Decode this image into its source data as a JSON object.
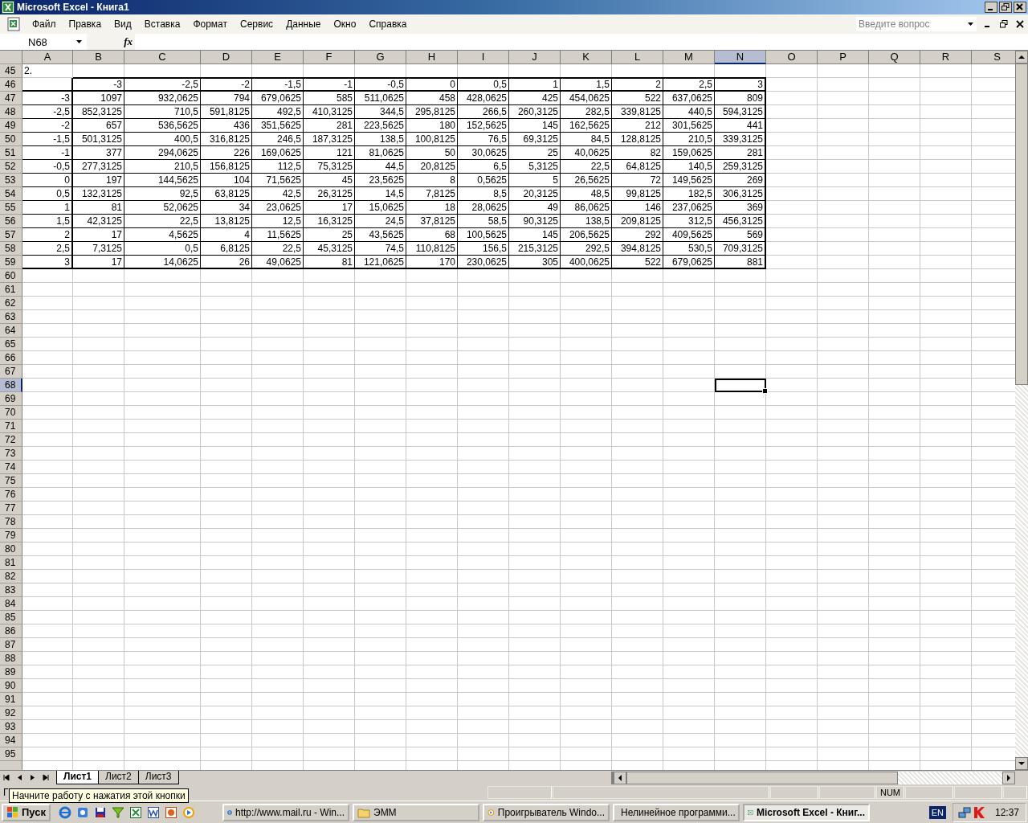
{
  "window": {
    "title": "Microsoft Excel - Книга1"
  },
  "menu": [
    "Файл",
    "Правка",
    "Вид",
    "Вставка",
    "Формат",
    "Сервис",
    "Данные",
    "Окно",
    "Справка"
  ],
  "help_search": {
    "placeholder": "Введите вопрос"
  },
  "name_box": {
    "value": "N68"
  },
  "formula_bar": {
    "label": "fx"
  },
  "sheet": {
    "columns": [
      {
        "label": "A",
        "selected": false
      },
      {
        "label": "B",
        "selected": false
      },
      {
        "label": "C",
        "selected": false
      },
      {
        "label": "D",
        "selected": false
      },
      {
        "label": "E",
        "selected": false
      },
      {
        "label": "F",
        "selected": false
      },
      {
        "label": "G",
        "selected": false
      },
      {
        "label": "H",
        "selected": false
      },
      {
        "label": "I",
        "selected": false
      },
      {
        "label": "J",
        "selected": false
      },
      {
        "label": "K",
        "selected": false
      },
      {
        "label": "L",
        "selected": false
      },
      {
        "label": "M",
        "selected": false
      },
      {
        "label": "N",
        "selected": true
      },
      {
        "label": "O",
        "selected": false
      },
      {
        "label": "P",
        "selected": false
      },
      {
        "label": "Q",
        "selected": false
      },
      {
        "label": "R",
        "selected": false
      },
      {
        "label": "S",
        "selected": false
      }
    ],
    "rows": [
      {
        "number": "45",
        "kind": "note",
        "selected": false,
        "cells": [
          "2."
        ]
      },
      {
        "number": "46",
        "kind": "table-head",
        "selected": false,
        "cells": [
          null,
          "-3",
          "-2,5",
          "-2",
          "-1,5",
          "-1",
          "-0,5",
          "0",
          "0,5",
          "1",
          "1,5",
          "2",
          "2,5",
          "3"
        ]
      },
      {
        "number": "47",
        "kind": "table-body",
        "selected": false,
        "cells": [
          "-3",
          "1097",
          "932,0625",
          "794",
          "679,0625",
          "585",
          "511,0625",
          "458",
          "428,0625",
          "425",
          "454,0625",
          "522",
          "637,0625",
          "809"
        ]
      },
      {
        "number": "48",
        "kind": "table-body",
        "selected": false,
        "cells": [
          "-2,5",
          "852,3125",
          "710,5",
          "591,8125",
          "492,5",
          "410,3125",
          "344,5",
          "295,8125",
          "266,5",
          "260,3125",
          "282,5",
          "339,8125",
          "440,5",
          "594,3125"
        ]
      },
      {
        "number": "49",
        "kind": "table-body",
        "selected": false,
        "cells": [
          "-2",
          "657",
          "536,5625",
          "436",
          "351,5625",
          "281",
          "223,5625",
          "180",
          "152,5625",
          "145",
          "162,5625",
          "212",
          "301,5625",
          "441"
        ]
      },
      {
        "number": "50",
        "kind": "table-body",
        "selected": false,
        "cells": [
          "-1,5",
          "501,3125",
          "400,5",
          "316,8125",
          "246,5",
          "187,3125",
          "138,5",
          "100,8125",
          "76,5",
          "69,3125",
          "84,5",
          "128,8125",
          "210,5",
          "339,3125"
        ]
      },
      {
        "number": "51",
        "kind": "table-body",
        "selected": false,
        "cells": [
          "-1",
          "377",
          "294,0625",
          "226",
          "169,0625",
          "121",
          "81,0625",
          "50",
          "30,0625",
          "25",
          "40,0625",
          "82",
          "159,0625",
          "281"
        ]
      },
      {
        "number": "52",
        "kind": "table-body",
        "selected": false,
        "cells": [
          "-0,5",
          "277,3125",
          "210,5",
          "156,8125",
          "112,5",
          "75,3125",
          "44,5",
          "20,8125",
          "6,5",
          "5,3125",
          "22,5",
          "64,8125",
          "140,5",
          "259,3125"
        ]
      },
      {
        "number": "53",
        "kind": "table-body",
        "selected": false,
        "cells": [
          "0",
          "197",
          "144,5625",
          "104",
          "71,5625",
          "45",
          "23,5625",
          "8",
          "0,5625",
          "5",
          "26,5625",
          "72",
          "149,5625",
          "269"
        ]
      },
      {
        "number": "54",
        "kind": "table-body",
        "selected": false,
        "cells": [
          "0,5",
          "132,3125",
          "92,5",
          "63,8125",
          "42,5",
          "26,3125",
          "14,5",
          "7,8125",
          "8,5",
          "20,3125",
          "48,5",
          "99,8125",
          "182,5",
          "306,3125"
        ]
      },
      {
        "number": "55",
        "kind": "table-body",
        "selected": false,
        "cells": [
          "1",
          "81",
          "52,0625",
          "34",
          "23,0625",
          "17",
          "15,0625",
          "18",
          "28,0625",
          "49",
          "86,0625",
          "146",
          "237,0625",
          "369"
        ]
      },
      {
        "number": "56",
        "kind": "table-body",
        "selected": false,
        "cells": [
          "1,5",
          "42,3125",
          "22,5",
          "13,8125",
          "12,5",
          "16,3125",
          "24,5",
          "37,8125",
          "58,5",
          "90,3125",
          "138,5",
          "209,8125",
          "312,5",
          "456,3125"
        ]
      },
      {
        "number": "57",
        "kind": "table-body",
        "selected": false,
        "cells": [
          "2",
          "17",
          "4,5625",
          "4",
          "11,5625",
          "25",
          "43,5625",
          "68",
          "100,5625",
          "145",
          "206,5625",
          "292",
          "409,5625",
          "569"
        ]
      },
      {
        "number": "58",
        "kind": "table-body",
        "selected": false,
        "cells": [
          "2,5",
          "7,3125",
          "0,5",
          "6,8125",
          "22,5",
          "45,3125",
          "74,5",
          "110,8125",
          "156,5",
          "215,3125",
          "292,5",
          "394,8125",
          "530,5",
          "709,3125"
        ]
      },
      {
        "number": "59",
        "kind": "table-body",
        "selected": false,
        "cells": [
          "3",
          "17",
          "14,0625",
          "26",
          "49,0625",
          "81",
          "121,0625",
          "170",
          "230,0625",
          "305",
          "400,0625",
          "522",
          "679,0625",
          "881"
        ]
      },
      {
        "number": "60",
        "kind": "empty",
        "selected": false
      },
      {
        "number": "61",
        "kind": "empty",
        "selected": false
      },
      {
        "number": "62",
        "kind": "empty",
        "selected": false
      },
      {
        "number": "63",
        "kind": "empty",
        "selected": false
      },
      {
        "number": "64",
        "kind": "empty",
        "selected": false
      },
      {
        "number": "65",
        "kind": "empty",
        "selected": false
      },
      {
        "number": "66",
        "kind": "empty",
        "selected": false
      },
      {
        "number": "67",
        "kind": "empty",
        "selected": false
      },
      {
        "number": "68",
        "kind": "empty",
        "selected": true
      },
      {
        "number": "69",
        "kind": "empty",
        "selected": false
      },
      {
        "number": "70",
        "kind": "empty",
        "selected": false
      },
      {
        "number": "71",
        "kind": "empty",
        "selected": false
      },
      {
        "number": "72",
        "kind": "empty",
        "selected": false
      },
      {
        "number": "73",
        "kind": "empty",
        "selected": false
      },
      {
        "number": "74",
        "kind": "empty",
        "selected": false
      },
      {
        "number": "75",
        "kind": "empty",
        "selected": false
      },
      {
        "number": "76",
        "kind": "empty",
        "selected": false
      },
      {
        "number": "77",
        "kind": "empty",
        "selected": false
      },
      {
        "number": "78",
        "kind": "empty",
        "selected": false
      },
      {
        "number": "79",
        "kind": "empty",
        "selected": false
      },
      {
        "number": "80",
        "kind": "empty",
        "selected": false
      },
      {
        "number": "81",
        "kind": "empty",
        "selected": false
      },
      {
        "number": "82",
        "kind": "empty",
        "selected": false
      },
      {
        "number": "83",
        "kind": "empty",
        "selected": false
      },
      {
        "number": "84",
        "kind": "empty",
        "selected": false
      },
      {
        "number": "85",
        "kind": "empty",
        "selected": false
      },
      {
        "number": "86",
        "kind": "empty",
        "selected": false
      },
      {
        "number": "87",
        "kind": "empty",
        "selected": false
      },
      {
        "number": "88",
        "kind": "empty",
        "selected": false
      },
      {
        "number": "89",
        "kind": "empty",
        "selected": false
      },
      {
        "number": "90",
        "kind": "empty",
        "selected": false
      },
      {
        "number": "91",
        "kind": "empty",
        "selected": false
      },
      {
        "number": "92",
        "kind": "empty",
        "selected": false
      },
      {
        "number": "93",
        "kind": "empty",
        "selected": false
      },
      {
        "number": "94",
        "kind": "empty",
        "selected": false
      },
      {
        "number": "95",
        "kind": "empty",
        "selected": false
      }
    ]
  },
  "sheet_tabs": [
    {
      "label": "Лист1",
      "selected": true
    },
    {
      "label": "Лист2",
      "selected": false
    },
    {
      "label": "Лист3",
      "selected": false
    }
  ],
  "status_bar": {
    "text": "Г",
    "indicators": [
      "NUM"
    ]
  },
  "tooltip": {
    "text": "Начните работу с нажатия этой кнопки"
  },
  "taskbar": {
    "start": "Пуск",
    "tasks": [
      {
        "kind": "browser",
        "label": "http://www.mail.ru - Win...",
        "selected": false
      },
      {
        "kind": "folder",
        "label": "ЭММ",
        "selected": false
      },
      {
        "kind": "media",
        "label": "Проигрыватель Windo...",
        "selected": false
      },
      {
        "kind": "document",
        "label": "Нелинейное программи...",
        "selected": false
      },
      {
        "kind": "spreadsheet",
        "label": "Microsoft Excel - Книг...",
        "selected": true
      }
    ],
    "language": "EN",
    "clock": "12:37"
  }
}
